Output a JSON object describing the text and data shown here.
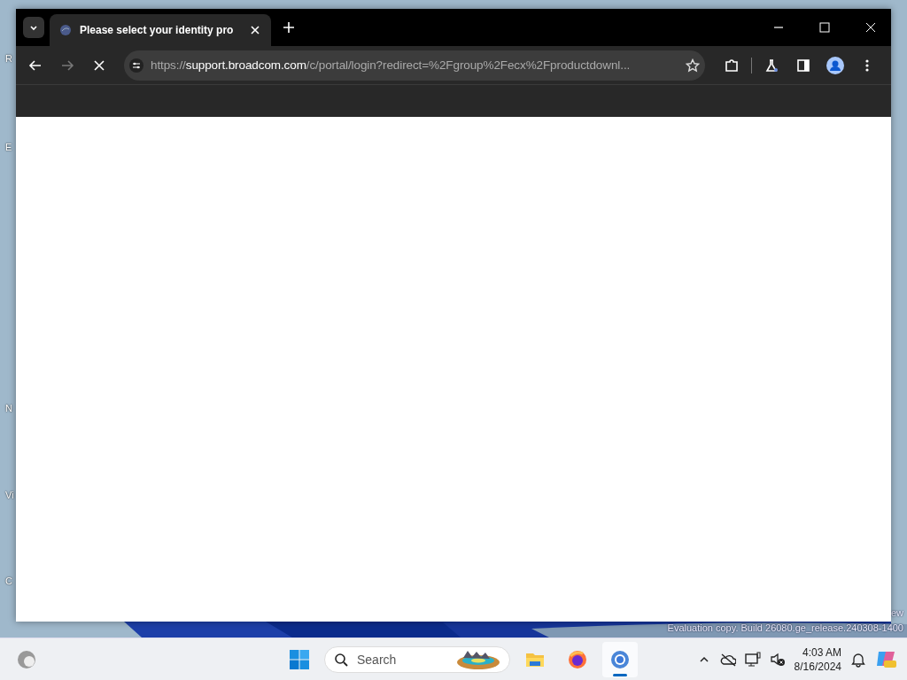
{
  "desktop": {
    "icon_labels": [
      "R",
      "E",
      "N",
      "Vi",
      "C"
    ],
    "watermark": [
      "ew",
      "Evaluation copy. Build 26080.ge_release.240308-1400"
    ]
  },
  "browser": {
    "tabs": [
      {
        "title": "Please select your identity pro",
        "selected": true
      }
    ],
    "address": {
      "host_prefix": "https://",
      "host": "support.broadcom.com",
      "path": "/c/portal/login?redirect=%2Fgroup%2Fecx%2Fproductdownl..."
    },
    "forward_disabled": true,
    "loading": true
  },
  "taskbar": {
    "search_placeholder": "Search",
    "apps": [
      {
        "kind": "explorer",
        "active": false
      },
      {
        "kind": "firefox",
        "active": false
      },
      {
        "kind": "chrome",
        "active": true
      }
    ],
    "time": "4:03 AM",
    "date": "8/16/2024"
  }
}
